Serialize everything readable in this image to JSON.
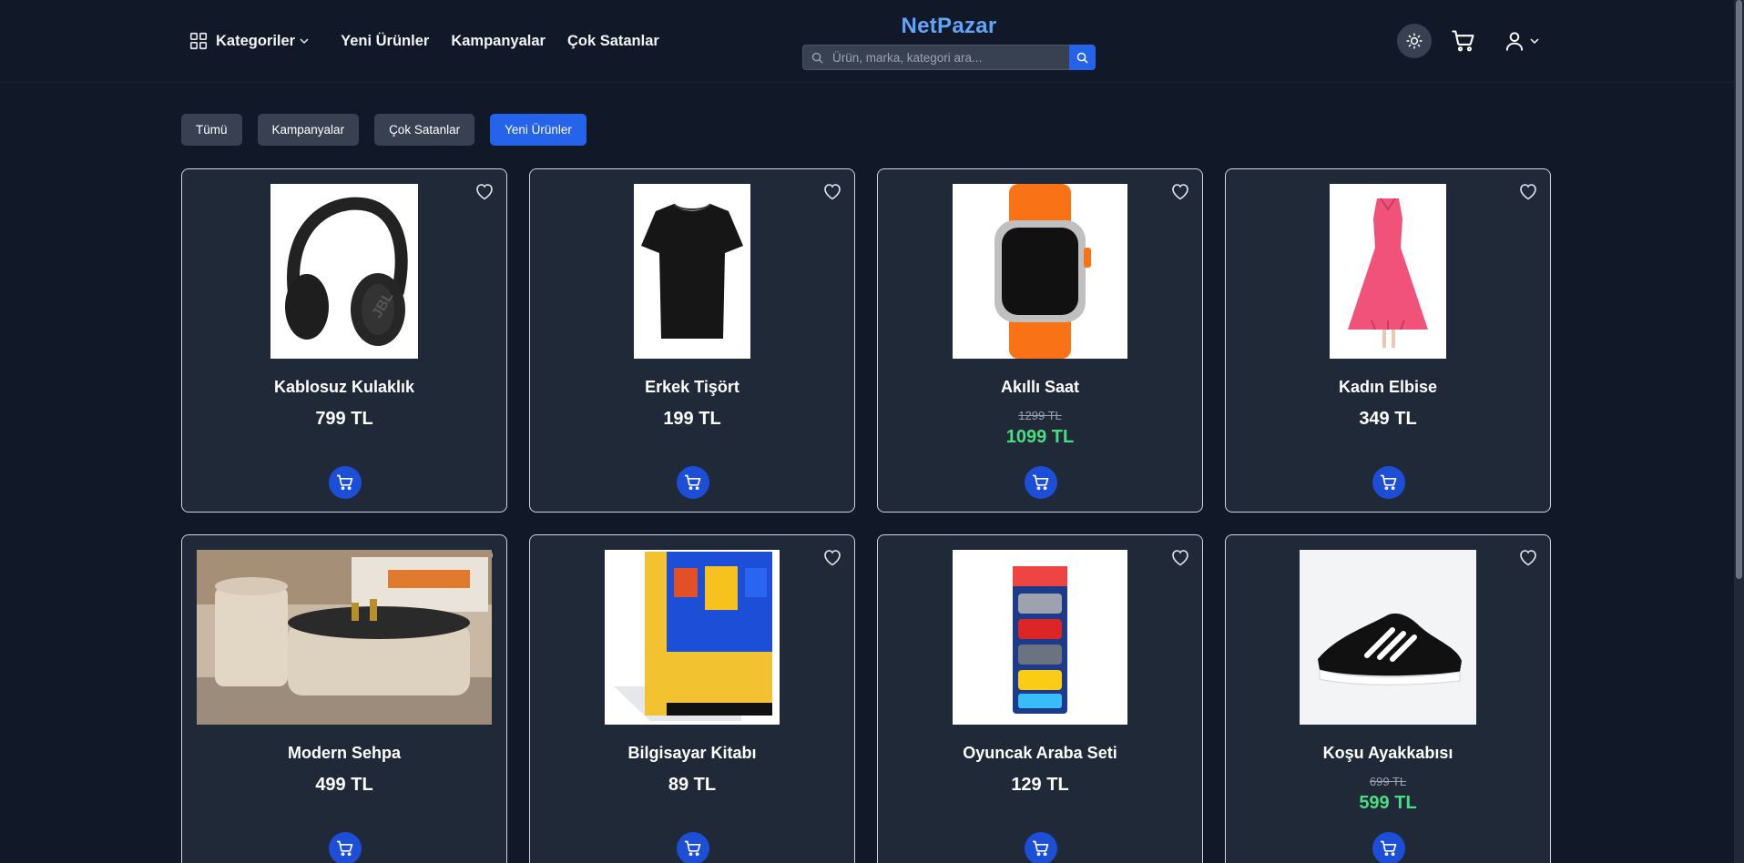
{
  "header": {
    "logo": "NetPazar",
    "nav": [
      {
        "label": "Kategoriler",
        "icon": "grid-icon",
        "dropdown": true
      },
      {
        "label": "Yeni Ürünler"
      },
      {
        "label": "Kampanyalar"
      },
      {
        "label": "Çok Satanlar"
      }
    ],
    "search": {
      "placeholder": "Ürün, marka, kategori ara...",
      "value": ""
    },
    "icons": [
      "sun-icon",
      "cart-icon",
      "user-icon",
      "chevron-down-icon"
    ]
  },
  "filters": [
    {
      "label": "Tümü",
      "active": false
    },
    {
      "label": "Kampanyalar",
      "active": false
    },
    {
      "label": "Çok Satanlar",
      "active": false
    },
    {
      "label": "Yeni Ürünler",
      "active": true
    }
  ],
  "products": [
    {
      "name": "Kablosuz Kulaklık",
      "price": "799 TL",
      "image": "headphones"
    },
    {
      "name": "Erkek Tişört",
      "price": "199 TL",
      "image": "tshirt"
    },
    {
      "name": "Akıllı Saat",
      "old_price": "1299 TL",
      "sale_price": "1099 TL",
      "image": "smartwatch"
    },
    {
      "name": "Kadın Elbise",
      "price": "349 TL",
      "image": "dress"
    },
    {
      "name": "Modern Sehpa",
      "price": "499 TL",
      "image": "coffee-table"
    },
    {
      "name": "Bilgisayar Kitabı",
      "price": "89 TL",
      "image": "book"
    },
    {
      "name": "Oyuncak Araba Seti",
      "price": "129 TL",
      "image": "toy-cars"
    },
    {
      "name": "Koşu Ayakkabısı",
      "old_price": "699 TL",
      "sale_price": "599 TL",
      "image": "running-shoe"
    }
  ],
  "colors": {
    "background": "#111827",
    "card": "#1f2937",
    "accent": "#2563eb",
    "logo": "#60a5fa",
    "sale": "#4ade80"
  }
}
